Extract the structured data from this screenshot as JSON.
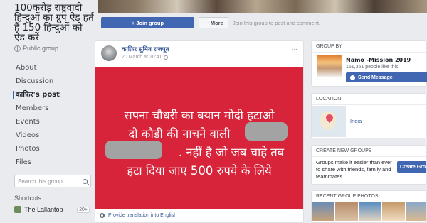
{
  "group": {
    "title": "100करोड़ राष्ट्रवादी हिन्दुओं का ग्रुप ऐड हर्त हैं 150 हिन्दुओं को ऐड करें",
    "privacy": "Public group"
  },
  "nav": [
    {
      "label": "About"
    },
    {
      "label": "Discussion"
    },
    {
      "label": "काफ़िर's post"
    },
    {
      "label": "Members"
    },
    {
      "label": "Events"
    },
    {
      "label": "Videos"
    },
    {
      "label": "Photos"
    },
    {
      "label": "Files"
    }
  ],
  "search": {
    "placeholder": "Search this group"
  },
  "shortcuts": {
    "title": "Shortcuts",
    "items": [
      {
        "label": "The Lallantop",
        "badge": "20+"
      }
    ]
  },
  "actions": {
    "join_label": "+ Join group",
    "more_label": "··· More",
    "hint": "Join this group to post and comment."
  },
  "post": {
    "author": "काफ़िर सुमित राजपूत",
    "time": "20 March at 20:41",
    "options": "...",
    "image_lines": [
      "सपना चौधरी का बयान मोदी हटाओ",
      "दो कौडी की नाचने वाली",
      ". नहीं है जो जब चाहे तब",
      "हटा दिया जाए 500 रुपये के लिये"
    ],
    "translate": "Provide translation into English"
  },
  "group_by": {
    "heading": "GROUP BY",
    "name": "Namo -Mission 2019",
    "likes": "161,361 people like this",
    "send_label": "Send Message"
  },
  "location": {
    "heading": "LOCATION",
    "value": "India"
  },
  "create": {
    "heading": "CREATE NEW GROUPS",
    "text": "Groups make it easier than ever to share with friends, family and teammates.",
    "button": "Create Grou"
  },
  "photos": {
    "heading": "RECENT GROUP PHOTOS"
  },
  "colors": {
    "brand": "#4267b2",
    "post_bg": "#d7243a",
    "page_bg": "#e9ebee"
  }
}
